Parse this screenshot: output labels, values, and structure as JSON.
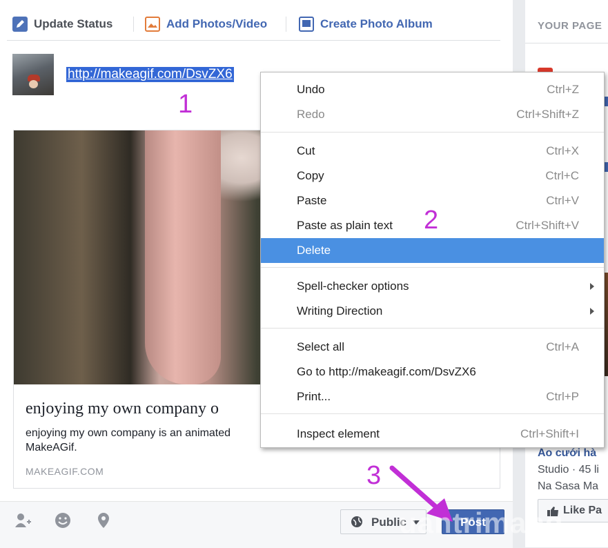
{
  "tabs": [
    {
      "label": "Update Status"
    },
    {
      "label": "Add Photos/Video"
    },
    {
      "label": "Create Photo Album"
    }
  ],
  "composer": {
    "url_text": "http://makeagif.com/DsvZX6"
  },
  "link_preview": {
    "title": "enjoying my own company o",
    "description": "enjoying my own company is an animated",
    "description_line2": "MakeAGif.",
    "domain": "MAKEAGIF.COM"
  },
  "bottom": {
    "privacy_label": "Public",
    "post_label": "Post"
  },
  "right_column": {
    "header": "YOUR PAGE",
    "card_title": "Áo cưới hà",
    "card_meta": "Studio · 45 li",
    "card_name": "Na Sasa Ma",
    "like_button": "Like Pa"
  },
  "context_menu": {
    "items": [
      {
        "label": "Undo",
        "shortcut": "Ctrl+Z"
      },
      {
        "label": "Redo",
        "shortcut": "Ctrl+Shift+Z"
      },
      {
        "label": "Cut",
        "shortcut": "Ctrl+X"
      },
      {
        "label": "Copy",
        "shortcut": "Ctrl+C"
      },
      {
        "label": "Paste",
        "shortcut": "Ctrl+V"
      },
      {
        "label": "Paste as plain text",
        "shortcut": "Ctrl+Shift+V"
      },
      {
        "label": "Delete",
        "shortcut": ""
      },
      {
        "label": "Spell-checker options",
        "shortcut": ""
      },
      {
        "label": "Writing Direction",
        "shortcut": ""
      },
      {
        "label": "Select all",
        "shortcut": "Ctrl+A"
      },
      {
        "label": "Go to http://makeagif.com/DsvZX6",
        "shortcut": ""
      },
      {
        "label": "Print...",
        "shortcut": "Ctrl+P"
      },
      {
        "label": "Inspect element",
        "shortcut": "Ctrl+Shift+I"
      }
    ]
  },
  "annotations": {
    "step1": "1",
    "step2": "2",
    "step3": "3",
    "annotation_color": "#c12fd6"
  },
  "watermark": "uantrimang",
  "colors": {
    "accent_blue": "#4267b2",
    "menu_highlight": "#4a90e2"
  }
}
